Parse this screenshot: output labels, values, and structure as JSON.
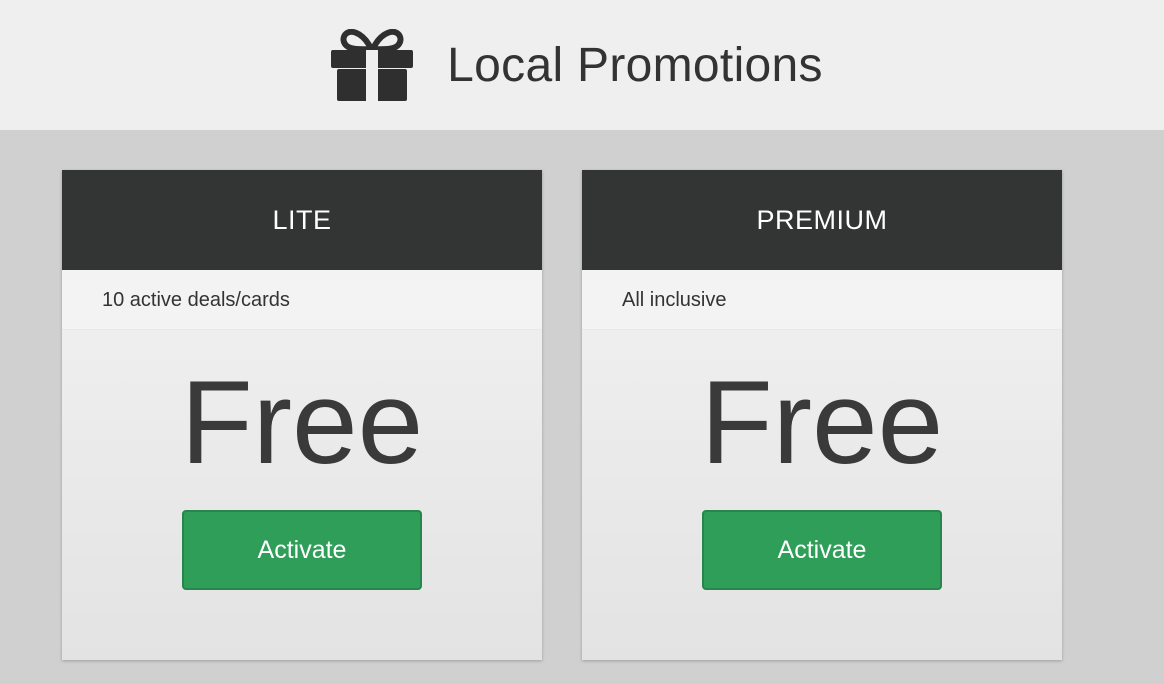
{
  "header": {
    "icon": "gift-icon",
    "title": "Local Promotions"
  },
  "plans": [
    {
      "name": "LITE",
      "feature": "10 active deals/cards",
      "price": "Free",
      "action_label": "Activate"
    },
    {
      "name": "PREMIUM",
      "feature": "All inclusive",
      "price": "Free",
      "action_label": "Activate"
    }
  ],
  "colors": {
    "header_bg": "#efefef",
    "page_bg": "#d0d0d0",
    "card_header_bg": "#333535",
    "button_bg": "#2e9e58"
  }
}
